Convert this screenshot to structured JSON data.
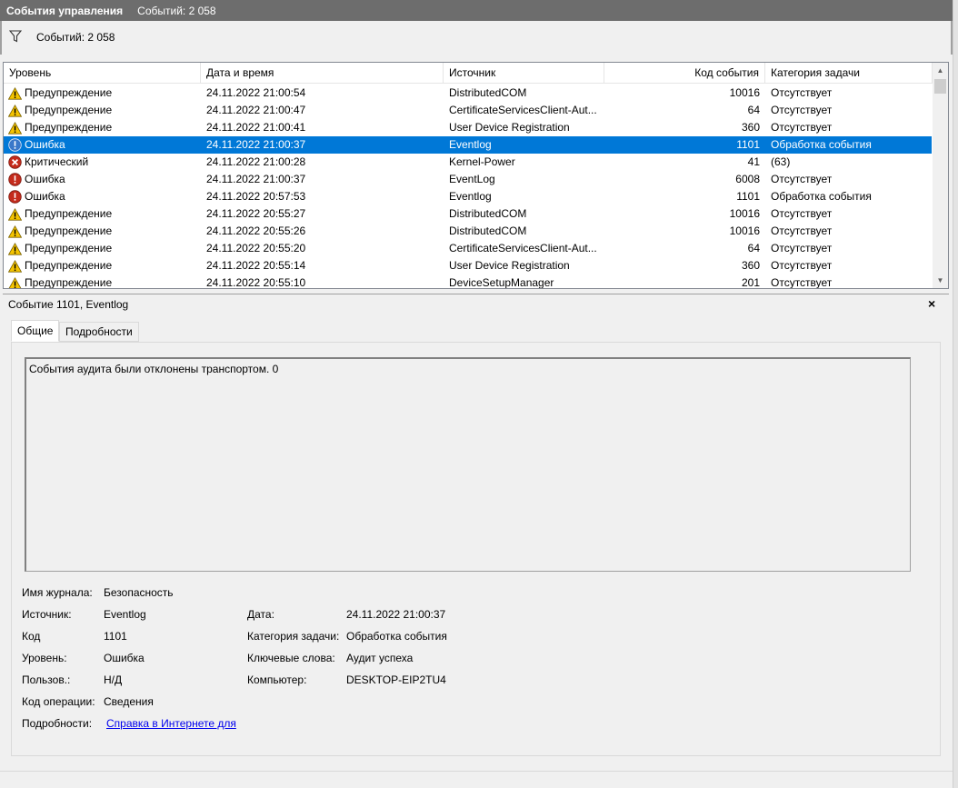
{
  "titlebar": {
    "title": "События управления",
    "count_text": "Событий: 2 058"
  },
  "filterbar": {
    "text": "Событий: 2 058"
  },
  "table": {
    "columns": [
      "Уровень",
      "Дата и время",
      "Источник",
      "Код события",
      "Категория задачи"
    ],
    "rows": [
      {
        "icon": "warning-icon",
        "level": "Предупреждение",
        "datetime": "24.11.2022 21:00:54",
        "source": "DistributedCOM",
        "code": "10016",
        "category": "Отсутствует",
        "selected": false
      },
      {
        "icon": "warning-icon",
        "level": "Предупреждение",
        "datetime": "24.11.2022 21:00:47",
        "source": "CertificateServicesClient-Aut...",
        "code": "64",
        "category": "Отсутствует",
        "selected": false
      },
      {
        "icon": "warning-icon",
        "level": "Предупреждение",
        "datetime": "24.11.2022 21:00:41",
        "source": "User Device Registration",
        "code": "360",
        "category": "Отсутствует",
        "selected": false
      },
      {
        "icon": "error-icon",
        "level": "Ошибка",
        "datetime": "24.11.2022 21:00:37",
        "source": "Eventlog",
        "code": "1101",
        "category": "Обработка события",
        "selected": true
      },
      {
        "icon": "critical-icon",
        "level": "Критический",
        "datetime": "24.11.2022 21:00:28",
        "source": "Kernel-Power",
        "code": "41",
        "category": "(63)",
        "selected": false
      },
      {
        "icon": "error-icon",
        "level": "Ошибка",
        "datetime": "24.11.2022 21:00:37",
        "source": "EventLog",
        "code": "6008",
        "category": "Отсутствует",
        "selected": false
      },
      {
        "icon": "error-icon",
        "level": "Ошибка",
        "datetime": "24.11.2022 20:57:53",
        "source": "Eventlog",
        "code": "1101",
        "category": "Обработка события",
        "selected": false
      },
      {
        "icon": "warning-icon",
        "level": "Предупреждение",
        "datetime": "24.11.2022 20:55:27",
        "source": "DistributedCOM",
        "code": "10016",
        "category": "Отсутствует",
        "selected": false
      },
      {
        "icon": "warning-icon",
        "level": "Предупреждение",
        "datetime": "24.11.2022 20:55:26",
        "source": "DistributedCOM",
        "code": "10016",
        "category": "Отсутствует",
        "selected": false
      },
      {
        "icon": "warning-icon",
        "level": "Предупреждение",
        "datetime": "24.11.2022 20:55:20",
        "source": "CertificateServicesClient-Aut...",
        "code": "64",
        "category": "Отсутствует",
        "selected": false
      },
      {
        "icon": "warning-icon",
        "level": "Предупреждение",
        "datetime": "24.11.2022 20:55:14",
        "source": "User Device Registration",
        "code": "360",
        "category": "Отсутствует",
        "selected": false
      },
      {
        "icon": "warning-icon",
        "level": "Предупреждение",
        "datetime": "24.11.2022 20:55:10",
        "source": "DeviceSetupManager",
        "code": "201",
        "category": "Отсутствует",
        "selected": false
      }
    ]
  },
  "detail": {
    "title": "Событие 1101, Eventlog",
    "close_glyph": "×",
    "tabs": [
      "Общие",
      "Подробности"
    ],
    "description": "События аудита были отклонены транспортом.  0",
    "props": {
      "log_name_label": "Имя журнала:",
      "log_name": "Безопасность",
      "source_label": "Источник:",
      "source": "Eventlog",
      "code_label": "Код",
      "code": "1101",
      "level_label": "Уровень:",
      "level": "Ошибка",
      "user_label": "Пользов.:",
      "user": "Н/Д",
      "opcode_label": "Код операции:",
      "opcode": "Сведения",
      "more_label": "Подробности:",
      "more_link": "Справка в Интернете для ",
      "date_label": "Дата:",
      "date": "24.11.2022 21:00:37",
      "category_label": "Категория задачи:",
      "category": "Обработка события",
      "keywords_label": "Ключевые слова:",
      "keywords": "Аудит успеха",
      "computer_label": "Компьютер:",
      "computer": "DESKTOP-EIP2TU4"
    }
  },
  "colors": {
    "selection": "#0078d7",
    "warning": "#f5c400",
    "error": "#c42b1c",
    "info_blue": "#3a78c9",
    "link": "#0000ee"
  }
}
